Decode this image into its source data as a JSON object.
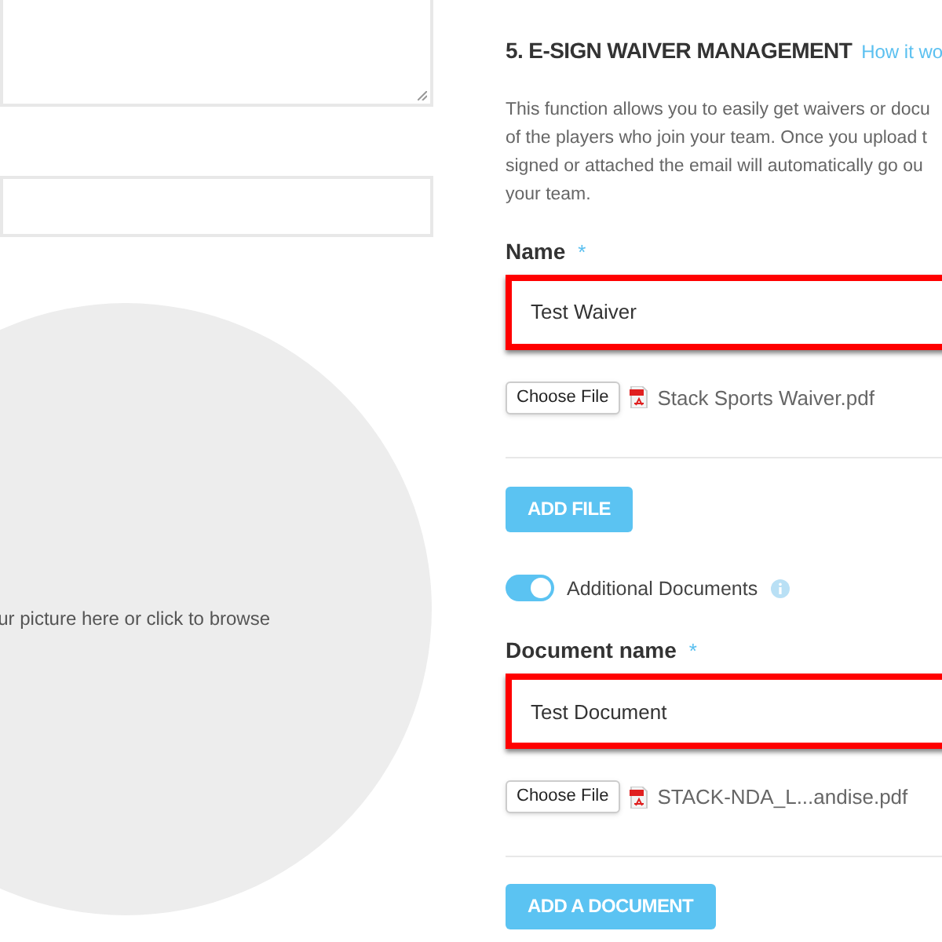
{
  "left": {
    "picture_drop": {
      "hint": "ur picture here or click to browse"
    }
  },
  "section": {
    "title": "5. E-SIGN WAIVER MANAGEMENT",
    "help_link": "How it wo",
    "description_lines": [
      "This function allows you to easily get waivers or docu",
      "of the players who join your team. Once you upload t",
      "signed or attached the email will automatically go ou",
      "your team."
    ],
    "name_field": {
      "label": "Name",
      "required_mark": "*",
      "value": "Test Waiver",
      "highlighted": true
    },
    "name_file": {
      "button": "Choose File",
      "file_name": "Stack Sports Waiver.pdf"
    },
    "add_file_button": "ADD FILE",
    "additional_documents": {
      "label": "Additional Documents",
      "on": true
    },
    "document_field": {
      "label": "Document name",
      "required_mark": "*",
      "value": "Test Document",
      "highlighted": true
    },
    "document_file": {
      "button": "Choose File",
      "file_name": "STACK-NDA_L...andise.pdf"
    },
    "add_document_button": "ADD A DOCUMENT"
  }
}
